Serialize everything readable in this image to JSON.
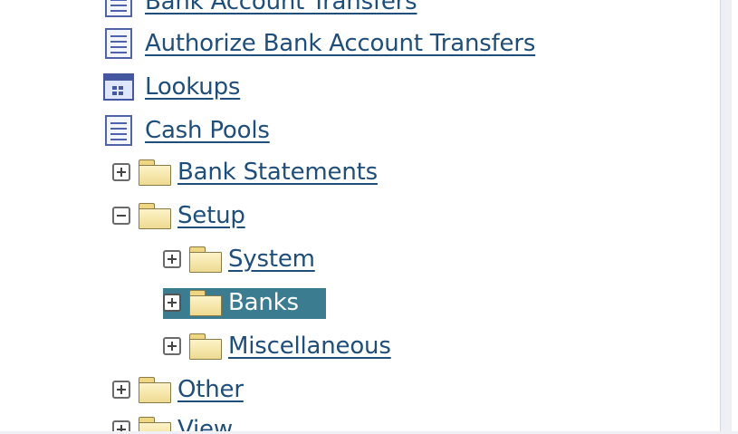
{
  "tree": {
    "items": [
      {
        "label": "Bank Account Transfers",
        "icon": "document-icon"
      },
      {
        "label": "Authorize Bank Account Transfers",
        "icon": "document-icon"
      },
      {
        "label": "Lookups",
        "icon": "window-icon"
      },
      {
        "label": "Cash Pools",
        "icon": "document-icon"
      },
      {
        "label": "Bank Statements",
        "icon": "folder-icon",
        "expander": "plus"
      },
      {
        "label": "Setup",
        "icon": "folder-icon",
        "expander": "minus"
      },
      {
        "label": "System",
        "icon": "folder-icon",
        "expander": "plus"
      },
      {
        "label": "Banks",
        "icon": "folder-icon",
        "expander": "plus",
        "selected": true
      },
      {
        "label": "Miscellaneous",
        "icon": "folder-icon",
        "expander": "plus"
      },
      {
        "label": "Other",
        "icon": "folder-icon",
        "expander": "plus"
      },
      {
        "label": "View",
        "icon": "folder-icon",
        "expander": "plus"
      }
    ]
  },
  "colors": {
    "link": "#1f4e7a",
    "selection": "#3b7c90",
    "folder": "#f5e3a0",
    "side_panel": "#eef0f6"
  }
}
